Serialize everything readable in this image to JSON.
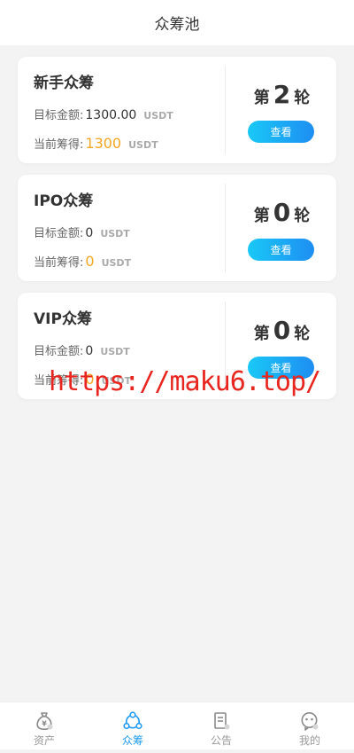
{
  "header": {
    "title": "众筹池"
  },
  "pools": [
    {
      "title": "新手众筹",
      "target_label": "目标金额:",
      "target_value": "1300.00",
      "target_unit": "USDT",
      "current_label": "当前筹得:",
      "current_value": "1300",
      "current_unit": "USDT",
      "round_prefix": "第",
      "round_number": "2",
      "round_suffix": "轮",
      "button": "查看"
    },
    {
      "title": "IPO众筹",
      "target_label": "目标金额:",
      "target_value": "0",
      "target_unit": "USDT",
      "current_label": "当前筹得:",
      "current_value": "0",
      "current_unit": "USDT",
      "round_prefix": "第",
      "round_number": "0",
      "round_suffix": "轮",
      "button": "查看"
    },
    {
      "title": "VIP众筹",
      "target_label": "目标金额:",
      "target_value": "0",
      "target_unit": "USDT",
      "current_label": "当前筹得:",
      "current_value": "0",
      "current_unit": "USDT",
      "round_prefix": "第",
      "round_number": "0",
      "round_suffix": "轮",
      "button": "查看"
    }
  ],
  "watermark": "https://maku6.top/",
  "tabbar": {
    "items": [
      {
        "label": "资产",
        "icon": "money-bag-icon",
        "active": false
      },
      {
        "label": "众筹",
        "icon": "share-network-icon",
        "active": true
      },
      {
        "label": "公告",
        "icon": "document-icon",
        "active": false
      },
      {
        "label": "我的",
        "icon": "user-face-icon",
        "active": false
      }
    ]
  },
  "colors": {
    "accent": "#1e9af3",
    "button_gradient_start": "#19c8f6",
    "button_gradient_end": "#1e8ef2",
    "amount_orange": "#f5a623",
    "watermark_red": "#e8261f",
    "background": "#f3f3f3"
  }
}
